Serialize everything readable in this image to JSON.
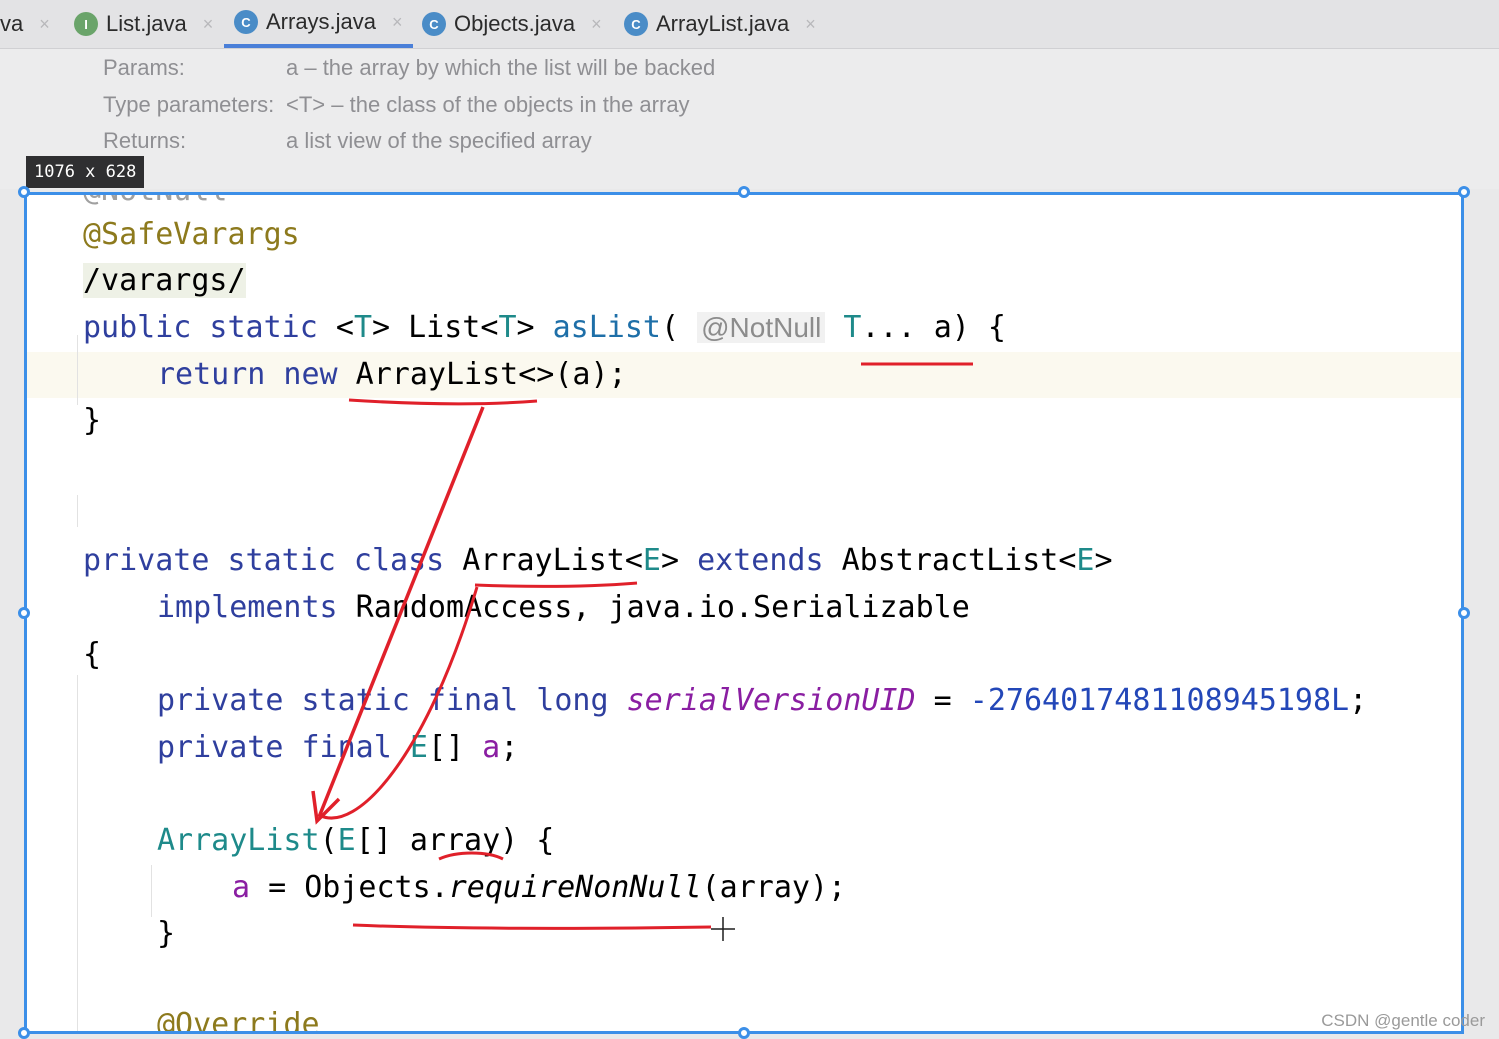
{
  "tabs": [
    {
      "label": "va",
      "icon": ""
    },
    {
      "label": "List.java",
      "icon": "I"
    },
    {
      "label": "Arrays.java",
      "icon": "C"
    },
    {
      "label": "Objects.java",
      "icon": "C"
    },
    {
      "label": "ArrayList.java",
      "icon": "C"
    }
  ],
  "doc": {
    "params_label": "Params:",
    "params_text": "a – the array by which the list will be backed",
    "type_label": "Type parameters:",
    "type_text": "<T> – the class of the objects in the array",
    "returns_label": "Returns:",
    "returns_text": "a list view of the specified array"
  },
  "selection": {
    "dimensions": "1076 x 628"
  },
  "code": {
    "l0": "@NotNull",
    "l1": "@SafeVarargs",
    "l2": "/varargs/",
    "l3_kw1": "public static",
    "l3_rest1": " <",
    "l3_t1": "T",
    "l3_rest2": "> List<",
    "l3_t2": "T",
    "l3_rest3": "> ",
    "l3_name": "asList",
    "l3_paren": "( ",
    "l3_hint": "@NotNull",
    "l3_t3": " T",
    "l3_rest4": "... a) {",
    "l4_kw": "return new",
    "l4_rest": " ArrayList<>(a);",
    "l5": "}",
    "l6_kw1": "private static class",
    "l6_name": " ArrayList<",
    "l6_e1": "E",
    "l6_mid": "> ",
    "l6_kw2": "extends",
    "l6_rest": " AbstractList<",
    "l6_e2": "E",
    "l6_end": ">",
    "l7_kw": "implements",
    "l7_rest": " RandomAccess, java.io.Serializable",
    "l8": "{",
    "l9_kw": "private static final long",
    "l9_fld": "serialVersionUID",
    "l9_eq": " = ",
    "l9_num": "-2764017481108945198L",
    "l9_end": ";",
    "l10_kw": "private final",
    "l10_e": " E",
    "l10_mid": "[] ",
    "l10_fld": "a",
    "l10_end": ";",
    "l11_name": "ArrayList",
    "l11_p": "(",
    "l11_e": "E",
    "l11_rest": "[] array) {",
    "l12_fld": "a",
    "l12_mid": " = Objects.",
    "l12_call": "requireNonNull",
    "l12_end": "(array);",
    "l13": "}",
    "l14": "@Override"
  },
  "watermark": "CSDN @gentle coder",
  "colors": {
    "selection": "#3c8fe8",
    "annotation_marks": "#e0202a"
  }
}
